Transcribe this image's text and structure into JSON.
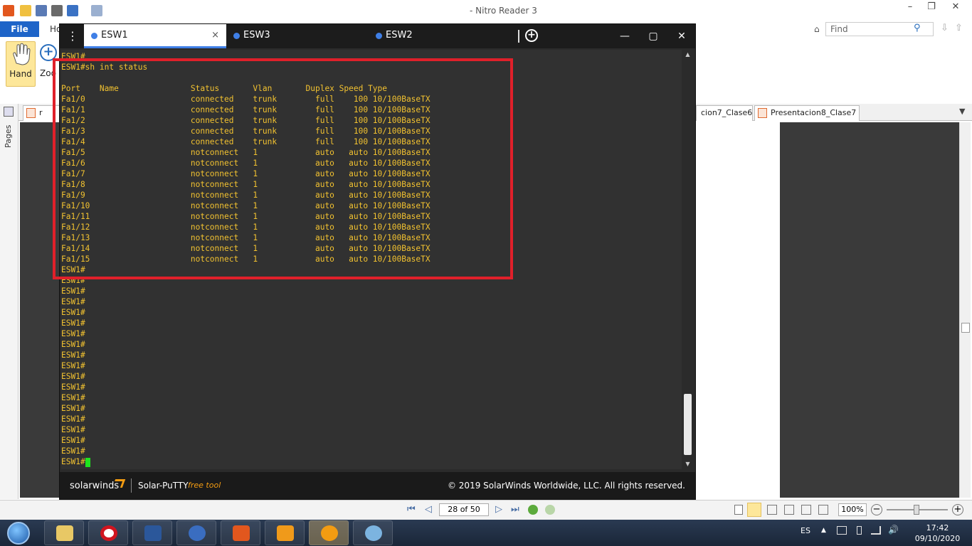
{
  "nitro": {
    "title": "- Nitro Reader 3",
    "file_tab": "File",
    "home_tab": "Ho",
    "hand_label": "Hand",
    "zoom_label": "Zoo",
    "find_placeholder": "Find",
    "pages_label": "Pages",
    "doc_tabs": [
      "r",
      "cion7_Clase6",
      "Presentacion8_Clase7"
    ],
    "page_indicator": "28 of 50",
    "zoom_level": "100%"
  },
  "putty": {
    "tabs": [
      {
        "label": "ESW1",
        "active": true
      },
      {
        "label": "ESW3",
        "active": false
      },
      {
        "label": "ESW2",
        "active": false
      }
    ],
    "menu_glyph": "⋮",
    "close_tab_glyph": "×",
    "add_tab_glyph": "+",
    "minimize_glyph": "—",
    "maximize_glyph": "▢",
    "close_glyph": "✕",
    "footer_brand": "solarwinds",
    "footer_product": "Solar-PuTTY",
    "footer_free": "free tool",
    "footer_copyright": "© 2019 SolarWinds Worldwide, LLC. All rights reserved.",
    "terminal_lines": [
      "ESW1#",
      "ESW1#sh int status",
      "",
      "Port    Name               Status       Vlan       Duplex Speed Type",
      "Fa1/0                      connected    trunk        full    100 10/100BaseTX",
      "Fa1/1                      connected    trunk        full    100 10/100BaseTX",
      "Fa1/2                      connected    trunk        full    100 10/100BaseTX",
      "Fa1/3                      connected    trunk        full    100 10/100BaseTX",
      "Fa1/4                      connected    trunk        full    100 10/100BaseTX",
      "Fa1/5                      notconnect   1            auto   auto 10/100BaseTX",
      "Fa1/6                      notconnect   1            auto   auto 10/100BaseTX",
      "Fa1/7                      notconnect   1            auto   auto 10/100BaseTX",
      "Fa1/8                      notconnect   1            auto   auto 10/100BaseTX",
      "Fa1/9                      notconnect   1            auto   auto 10/100BaseTX",
      "Fa1/10                     notconnect   1            auto   auto 10/100BaseTX",
      "Fa1/11                     notconnect   1            auto   auto 10/100BaseTX",
      "Fa1/12                     notconnect   1            auto   auto 10/100BaseTX",
      "Fa1/13                     notconnect   1            auto   auto 10/100BaseTX",
      "Fa1/14                     notconnect   1            auto   auto 10/100BaseTX",
      "Fa1/15                     notconnect   1            auto   auto 10/100BaseTX",
      "ESW1#",
      "ESW1#",
      "ESW1#",
      "ESW1#",
      "ESW1#",
      "ESW1#",
      "ESW1#",
      "ESW1#",
      "ESW1#",
      "ESW1#",
      "ESW1#",
      "ESW1#",
      "ESW1#",
      "ESW1#",
      "ESW1#",
      "ESW1#",
      "ESW1#",
      "ESW1#"
    ],
    "prompt": "ESW1#"
  },
  "taskbar": {
    "language": "ES",
    "time": "17:42",
    "date": "09/10/2020",
    "apps": [
      "file-explorer-icon",
      "opera-icon",
      "word-icon",
      "app-icon",
      "nitro-icon",
      "sublime-icon",
      "solar-putty-icon",
      "paint-icon"
    ]
  },
  "colors": {
    "terminal_text": "#f2c230",
    "terminal_bg": "#313131",
    "highlight_box": "#e0202a",
    "tab_accent": "#3f7fe6",
    "cursor": "#1ee51e"
  }
}
